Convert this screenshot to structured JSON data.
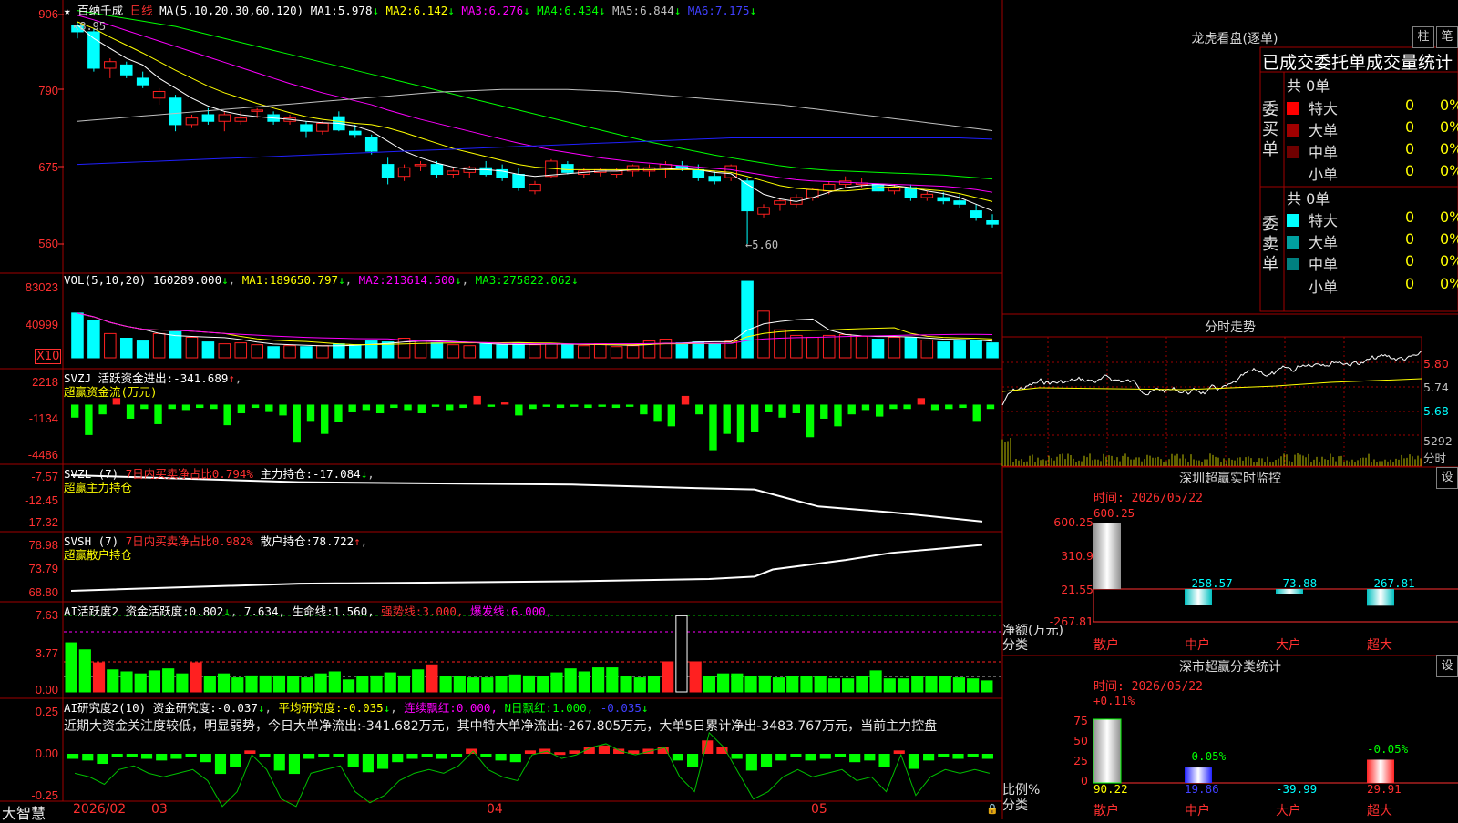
{
  "colors": {
    "up": "#ff2020",
    "down": "#00ffff",
    "grid": "#a00000",
    "ma1": "#ffffff",
    "ma2": "#ffff00",
    "ma3": "#ff00ff",
    "ma4": "#00ff00",
    "ma5": "#c0c0c0",
    "ma6": "#2020ff",
    "bull": "#ff2020",
    "bear": "#00ff00"
  },
  "price_panel": {
    "title_star": "★",
    "stock_name": "百纳千成",
    "period": "日线",
    "ma_params": "MA(5,10,20,30,60,120)",
    "ma": [
      {
        "label": "MA1:",
        "value": "5.978",
        "arrow": "↓"
      },
      {
        "label": "MA2:",
        "value": "6.142",
        "arrow": "↓"
      },
      {
        "label": "MA3:",
        "value": "6.276",
        "arrow": "↓"
      },
      {
        "label": "MA4:",
        "value": "6.434",
        "arrow": "↓"
      },
      {
        "label": "MA5:",
        "value": "6.844",
        "arrow": "↓"
      },
      {
        "label": "MA6:",
        "value": "7.175",
        "arrow": "↓"
      }
    ],
    "y_labels": [
      "906",
      "790",
      "675",
      "560"
    ],
    "y_values": [
      9.06,
      7.9,
      6.75,
      5.6
    ],
    "high_marker": "8.95",
    "low_marker": "←5.60",
    "candles": [
      [
        8.9,
        8.95,
        8.7,
        8.8
      ],
      [
        8.8,
        8.85,
        8.2,
        8.25
      ],
      [
        8.25,
        8.4,
        8.1,
        8.35
      ],
      [
        8.3,
        8.35,
        8.1,
        8.15
      ],
      [
        8.1,
        8.2,
        7.95,
        8.0
      ],
      [
        7.8,
        7.95,
        7.7,
        7.9
      ],
      [
        7.8,
        7.85,
        7.3,
        7.4
      ],
      [
        7.4,
        7.55,
        7.35,
        7.5
      ],
      [
        7.55,
        7.65,
        7.4,
        7.45
      ],
      [
        7.45,
        7.6,
        7.3,
        7.55
      ],
      [
        7.45,
        7.6,
        7.4,
        7.5
      ],
      [
        7.6,
        7.65,
        7.5,
        7.62
      ],
      [
        7.55,
        7.6,
        7.4,
        7.45
      ],
      [
        7.45,
        7.55,
        7.4,
        7.5
      ],
      [
        7.4,
        7.45,
        7.2,
        7.3
      ],
      [
        7.3,
        7.45,
        7.25,
        7.42
      ],
      [
        7.52,
        7.6,
        7.3,
        7.32
      ],
      [
        7.3,
        7.4,
        7.2,
        7.25
      ],
      [
        7.2,
        7.25,
        6.95,
        7.0
      ],
      [
        6.8,
        6.9,
        6.5,
        6.6
      ],
      [
        6.62,
        6.8,
        6.55,
        6.75
      ],
      [
        6.78,
        6.85,
        6.7,
        6.8
      ],
      [
        6.8,
        6.85,
        6.6,
        6.65
      ],
      [
        6.65,
        6.75,
        6.6,
        6.7
      ],
      [
        6.68,
        6.78,
        6.6,
        6.75
      ],
      [
        6.75,
        6.85,
        6.62,
        6.65
      ],
      [
        6.72,
        6.8,
        6.55,
        6.6
      ],
      [
        6.65,
        6.75,
        6.4,
        6.45
      ],
      [
        6.4,
        6.55,
        6.35,
        6.5
      ],
      [
        6.62,
        6.88,
        6.6,
        6.85
      ],
      [
        6.8,
        6.85,
        6.65,
        6.68
      ],
      [
        6.65,
        6.75,
        6.6,
        6.7
      ],
      [
        6.68,
        6.75,
        6.62,
        6.72
      ],
      [
        6.65,
        6.75,
        6.6,
        6.7
      ],
      [
        6.7,
        6.8,
        6.62,
        6.78
      ],
      [
        6.7,
        6.8,
        6.62,
        6.75
      ],
      [
        6.75,
        6.85,
        6.6,
        6.8
      ],
      [
        6.78,
        6.85,
        6.7,
        6.75
      ],
      [
        6.72,
        6.8,
        6.55,
        6.6
      ],
      [
        6.62,
        6.7,
        6.5,
        6.55
      ],
      [
        6.6,
        6.8,
        6.55,
        6.78
      ],
      [
        6.55,
        6.6,
        5.6,
        6.1
      ],
      [
        6.05,
        6.2,
        6.0,
        6.15
      ],
      [
        6.2,
        6.3,
        6.1,
        6.25
      ],
      [
        6.2,
        6.35,
        6.15,
        6.3
      ],
      [
        6.3,
        6.45,
        6.25,
        6.42
      ],
      [
        6.4,
        6.55,
        6.35,
        6.5
      ],
      [
        6.5,
        6.62,
        6.45,
        6.55
      ],
      [
        6.5,
        6.6,
        6.45,
        6.52
      ],
      [
        6.5,
        6.55,
        6.35,
        6.4
      ],
      [
        6.4,
        6.5,
        6.35,
        6.45
      ],
      [
        6.45,
        6.5,
        6.25,
        6.3
      ],
      [
        6.3,
        6.4,
        6.25,
        6.35
      ],
      [
        6.3,
        6.38,
        6.2,
        6.25
      ],
      [
        6.25,
        6.35,
        6.15,
        6.2
      ],
      [
        6.1,
        6.2,
        5.95,
        6.0
      ],
      [
        5.95,
        6.05,
        5.85,
        5.9
      ]
    ],
    "ma_series": {
      "ma1": [
        8.9,
        8.7,
        8.55,
        8.4,
        8.3,
        8.1,
        7.95,
        7.8,
        7.68,
        7.6,
        7.55,
        7.52,
        7.5,
        7.48,
        7.45,
        7.43,
        7.42,
        7.38,
        7.3,
        7.15,
        7.0,
        6.9,
        6.82,
        6.76,
        6.72,
        6.72,
        6.7,
        6.65,
        6.62,
        6.64,
        6.66,
        6.68,
        6.7,
        6.7,
        6.72,
        6.72,
        6.73,
        6.74,
        6.72,
        6.68,
        6.66,
        6.5,
        6.35,
        6.28,
        6.24,
        6.3,
        6.38,
        6.45,
        6.48,
        6.5,
        6.48,
        6.45,
        6.4,
        6.36,
        6.3,
        6.2,
        6.1
      ],
      "ma2": [
        8.95,
        8.85,
        8.72,
        8.6,
        8.48,
        8.35,
        8.22,
        8.1,
        7.98,
        7.88,
        7.8,
        7.72,
        7.65,
        7.58,
        7.52,
        7.48,
        7.45,
        7.42,
        7.4,
        7.35,
        7.28,
        7.2,
        7.12,
        7.04,
        6.98,
        6.92,
        6.86,
        6.8,
        6.76,
        6.74,
        6.72,
        6.72,
        6.72,
        6.72,
        6.72,
        6.72,
        6.72,
        6.72,
        6.72,
        6.7,
        6.68,
        6.62,
        6.55,
        6.48,
        6.44,
        6.42,
        6.4,
        6.4,
        6.42,
        6.45,
        6.46,
        6.44,
        6.42,
        6.4,
        6.36,
        6.3,
        6.24
      ],
      "ma3": [
        9.05,
        8.98,
        8.9,
        8.82,
        8.74,
        8.66,
        8.58,
        8.5,
        8.42,
        8.34,
        8.26,
        8.18,
        8.1,
        8.02,
        7.95,
        7.88,
        7.82,
        7.76,
        7.7,
        7.62,
        7.55,
        7.48,
        7.42,
        7.36,
        7.3,
        7.24,
        7.18,
        7.12,
        7.07,
        7.02,
        6.98,
        6.94,
        6.9,
        6.87,
        6.84,
        6.82,
        6.8,
        6.78,
        6.76,
        6.74,
        6.72,
        6.68,
        6.64,
        6.6,
        6.57,
        6.55,
        6.54,
        6.53,
        6.52,
        6.51,
        6.5,
        6.49,
        6.48,
        6.47,
        6.45,
        6.42,
        6.38
      ],
      "ma4": [
        9.12,
        9.08,
        9.04,
        9.0,
        8.96,
        8.92,
        8.88,
        8.82,
        8.76,
        8.7,
        8.64,
        8.58,
        8.52,
        8.46,
        8.4,
        8.34,
        8.28,
        8.22,
        8.16,
        8.1,
        8.04,
        7.98,
        7.92,
        7.86,
        7.8,
        7.74,
        7.68,
        7.62,
        7.56,
        7.5,
        7.44,
        7.38,
        7.32,
        7.26,
        7.2,
        7.14,
        7.09,
        7.04,
        6.99,
        6.94,
        6.9,
        6.86,
        6.82,
        6.78,
        6.75,
        6.73,
        6.71,
        6.7,
        6.69,
        6.68,
        6.67,
        6.66,
        6.65,
        6.64,
        6.62,
        6.6,
        6.58
      ],
      "ma5": [
        7.45,
        7.47,
        7.49,
        7.51,
        7.53,
        7.55,
        7.57,
        7.59,
        7.61,
        7.63,
        7.65,
        7.67,
        7.69,
        7.71,
        7.73,
        7.75,
        7.77,
        7.79,
        7.81,
        7.83,
        7.85,
        7.87,
        7.89,
        7.9,
        7.91,
        7.92,
        7.93,
        7.93,
        7.93,
        7.93,
        7.93,
        7.92,
        7.91,
        7.9,
        7.88,
        7.86,
        7.84,
        7.82,
        7.8,
        7.78,
        7.76,
        7.74,
        7.72,
        7.7,
        7.67,
        7.64,
        7.61,
        7.58,
        7.55,
        7.52,
        7.49,
        7.46,
        7.43,
        7.4,
        7.37,
        7.34,
        7.31
      ],
      "ma6": [
        6.8,
        6.81,
        6.82,
        6.83,
        6.84,
        6.85,
        6.86,
        6.87,
        6.88,
        6.89,
        6.9,
        6.91,
        6.92,
        6.93,
        6.94,
        6.95,
        6.96,
        6.97,
        6.98,
        6.99,
        7.0,
        7.01,
        7.02,
        7.03,
        7.04,
        7.05,
        7.06,
        7.07,
        7.08,
        7.09,
        7.1,
        7.11,
        7.12,
        7.13,
        7.14,
        7.15,
        7.16,
        7.17,
        7.18,
        7.19,
        7.2,
        7.2,
        7.2,
        7.2,
        7.2,
        7.2,
        7.2,
        7.2,
        7.2,
        7.2,
        7.2,
        7.2,
        7.2,
        7.2,
        7.2,
        7.19,
        7.18
      ]
    }
  },
  "vol_panel": {
    "header": "VOL(5,10,20)",
    "value": "160289.000",
    "ma": [
      {
        "label": "MA1:",
        "value": "189650.797",
        "arrow": "↓"
      },
      {
        "label": "MA2:",
        "value": "213614.500",
        "arrow": "↓"
      },
      {
        "label": "MA3:",
        "value": "275822.062",
        "arrow": "↓"
      }
    ],
    "y_labels": [
      "83023",
      "40999"
    ],
    "unit": "X10",
    "values": [
      48000,
      40000,
      26000,
      21000,
      18000,
      26000,
      28000,
      22000,
      17000,
      15000,
      16000,
      14000,
      12000,
      13000,
      12000,
      13000,
      15000,
      14000,
      18000,
      17000,
      21000,
      19000,
      16000,
      14000,
      13000,
      15000,
      14000,
      16000,
      14000,
      15000,
      14000,
      13000,
      15000,
      12000,
      13000,
      18000,
      20000,
      16000,
      17000,
      15000,
      18000,
      82000,
      50000,
      30000,
      24000,
      22000,
      24000,
      25000,
      23000,
      20000,
      22000,
      22000,
      19000,
      17000,
      18000,
      19000,
      16000
    ]
  },
  "svzj_panel": {
    "header": "SVZJ",
    "label": "活跃资金进出:",
    "value": "-341.689",
    "arrow": "↑",
    "subtitle": "超赢资金流(万元)",
    "y_labels": [
      "2218",
      "-1134",
      "-4486"
    ],
    "values": [
      -1200,
      -2800,
      -900,
      600,
      -1300,
      -400,
      -1800,
      -400,
      -500,
      -300,
      -400,
      -1900,
      -800,
      -300,
      -600,
      -1000,
      -3500,
      -1500,
      -2700,
      -1600,
      -700,
      -500,
      -800,
      -300,
      -500,
      -800,
      -200,
      -500,
      -300,
      800,
      -200,
      200,
      -1000,
      -400,
      -200,
      -300,
      -200,
      -300,
      -200,
      -300,
      -200,
      -900,
      -1500,
      -2000,
      800,
      -900,
      -4200,
      -2700,
      -3500,
      -2500,
      -700,
      -1200,
      -800,
      -3000,
      -1300,
      -2000,
      -900,
      -500,
      -1100,
      -400,
      -400,
      600,
      -500,
      -400,
      -300,
      -1500,
      -400
    ]
  },
  "svzl_panel": {
    "header": "SVZL (7)",
    "sub1": "7日内买卖净占比0.794%",
    "label": "主力持仓:",
    "value": "-17.084",
    "arrow": "↓",
    "subtitle": "超赢主力持仓",
    "y_labels": [
      "-7.57",
      "-12.45",
      "-17.32"
    ],
    "points": [
      [
        0,
        -7.57
      ],
      [
        0.25,
        -9.0
      ],
      [
        0.55,
        -9.5
      ],
      [
        0.68,
        -10.2
      ],
      [
        0.75,
        -10.5
      ],
      [
        0.82,
        -14.0
      ],
      [
        0.9,
        -15.2
      ],
      [
        1.0,
        -17.1
      ]
    ]
  },
  "svsh_panel": {
    "header": "SVSH (7)",
    "sub1": "7日内买卖净占比0.982%",
    "label": "散户持仓:",
    "value": "78.722",
    "arrow": "↑",
    "subtitle": "超赢散户持仓",
    "y_labels": [
      "78.98",
      "73.79",
      "68.80"
    ],
    "points": [
      [
        0,
        69.0
      ],
      [
        0.25,
        70.5
      ],
      [
        0.55,
        71.0
      ],
      [
        0.7,
        71.5
      ],
      [
        0.75,
        72.0
      ],
      [
        0.77,
        73.5
      ],
      [
        0.85,
        75.5
      ],
      [
        0.9,
        77.0
      ],
      [
        1.0,
        78.7
      ]
    ]
  },
  "ai_active_panel": {
    "header": "AI活跃度2",
    "label": "资金活跃度:",
    "value": "0.802",
    "arrow": "↓",
    "value2": "7.634,",
    "life_label": "生命线:",
    "life": "1.560,",
    "strong_label": "强势线:",
    "strong": "3.000,",
    "burst_label": "爆发线:",
    "burst": "6.000,",
    "y_labels": [
      "7.63",
      "3.77",
      "0.00"
    ],
    "values": [
      4.9,
      4.2,
      2.9,
      2.2,
      2.0,
      1.8,
      2.1,
      2.3,
      1.8,
      2.9,
      1.5,
      1.8,
      1.4,
      1.6,
      1.6,
      1.6,
      1.5,
      1.4,
      1.8,
      2.0,
      1.2,
      1.5,
      1.6,
      1.9,
      1.6,
      2.2,
      2.7,
      1.5,
      1.5,
      1.4,
      1.4,
      1.5,
      1.7,
      1.6,
      1.5,
      1.9,
      2.3,
      2.0,
      2.4,
      2.4,
      1.5,
      1.4,
      1.5,
      3.0,
      7.6,
      3.0,
      1.5,
      1.8,
      1.8,
      1.5,
      1.6,
      1.4,
      1.5,
      1.5,
      1.5,
      1.3,
      1.3,
      1.5,
      2.1,
      1.3,
      1.3,
      1.5,
      1.5,
      1.5,
      1.4,
      1.3,
      1.1
    ]
  },
  "ai_research_panel": {
    "header": "AI研究度2(10)",
    "label": "资金研究度:",
    "value": "-0.037",
    "arrow": "↓",
    "avg_label": "平均研究度:",
    "avg": "-0.035",
    "avg_arrow": "↓",
    "cont_label": "连续飘红:",
    "cont": "0.000,",
    "n_label": "N日飘红:",
    "n": "1.000,",
    "last": "-0.035",
    "last_arrow": "↓",
    "comment": "近期大资金关注度较低，明显弱势，今日大单净流出:-341.682万元，其中特大单净流出:-267.805万元，大单5日累计净出-3483.767万元，当前主力控盘",
    "y_labels": [
      "0.25",
      "0.00",
      "-0.25"
    ],
    "values": [
      -0.03,
      -0.04,
      -0.06,
      -0.02,
      -0.01,
      -0.03,
      -0.04,
      -0.03,
      -0.02,
      -0.05,
      -0.12,
      -0.08,
      0.02,
      -0.02,
      -0.1,
      -0.12,
      -0.03,
      -0.02,
      -0.01,
      -0.08,
      -0.11,
      -0.09,
      -0.05,
      -0.03,
      -0.02,
      -0.03,
      -0.01,
      0.03,
      -0.02,
      -0.04,
      -0.05,
      0.02,
      0.03,
      0.01,
      0.02,
      0.04,
      0.05,
      0.03,
      0.02,
      0.03,
      0.04,
      -0.04,
      -0.08,
      0.08,
      0.04,
      -0.03,
      -0.1,
      -0.08,
      -0.04,
      -0.02,
      -0.04,
      -0.03,
      -0.02,
      -0.05,
      -0.04,
      -0.08,
      0.02,
      -0.09,
      -0.04,
      -0.02,
      -0.03,
      -0.02,
      -0.03
    ]
  },
  "x_axis": {
    "labels": [
      "2026/02",
      "03",
      "04",
      "05"
    ],
    "footer_brand": "大智慧"
  },
  "dragon": {
    "title": "龙虎看盘(逐单)",
    "btn1": "柱",
    "btn2": "笔",
    "header": "已成交委托单成交量统计",
    "buy_group": {
      "label": "委买单",
      "total": "共 0单",
      "rows": [
        {
          "name": "特大",
          "count": "0",
          "pct": "0%",
          "color": "#ff0000"
        },
        {
          "name": "大单",
          "count": "0",
          "pct": "0%",
          "color": "#a00000"
        },
        {
          "name": "中单",
          "count": "0",
          "pct": "0%",
          "color": "#700000"
        },
        {
          "name": "小单",
          "count": "0",
          "pct": "0%",
          "color": "#000000"
        }
      ]
    },
    "sell_group": {
      "label": "委卖单",
      "total": "共 0单",
      "rows": [
        {
          "name": "特大",
          "count": "0",
          "pct": "0%",
          "color": "#00ffff"
        },
        {
          "name": "大单",
          "count": "0",
          "pct": "0%",
          "color": "#00a0a0"
        },
        {
          "name": "中单",
          "count": "0",
          "pct": "0%",
          "color": "#008080"
        },
        {
          "name": "小单",
          "count": "0",
          "pct": "0%",
          "color": "#000000"
        }
      ]
    }
  },
  "intraday": {
    "title": "分时走势",
    "y_labels": [
      "5.80",
      "5.74",
      "5.68"
    ],
    "vol_label": "5292",
    "vol_unit": "分时"
  },
  "sz_monitor": {
    "title": "深圳超赢实时监控",
    "btn": "设",
    "time_label": "时间:",
    "time": "2026/05/22",
    "y_labels": [
      "600.25",
      "310.9",
      "21.55",
      "-267.81"
    ],
    "axis_title": "净额(万元)",
    "axis_sub": "分类",
    "cats": [
      "散户",
      "中户",
      "大户",
      "超大"
    ],
    "values": [
      600.25,
      -258.57,
      -73.88,
      -267.81
    ],
    "value_labels": [
      "600.25",
      "-258.57",
      "-73.88",
      "-267.81"
    ]
  },
  "sz_class": {
    "title": "深市超赢分类统计",
    "btn": "设",
    "time_label": "时间:",
    "time": "2026/05/22",
    "y_labels": [
      "75",
      "50",
      "25",
      "0"
    ],
    "axis_title": "比例%",
    "axis_sub": "分类",
    "cats": [
      "散户",
      "中户",
      "大户",
      "超大"
    ],
    "top_labels": [
      "+0.11%",
      "-0.05%",
      "",
      "-0.05%"
    ],
    "bottom_values": [
      "90.22",
      "19.86",
      "-39.99",
      "29.91"
    ],
    "values": [
      90.22,
      19.86,
      0,
      29.91
    ]
  }
}
